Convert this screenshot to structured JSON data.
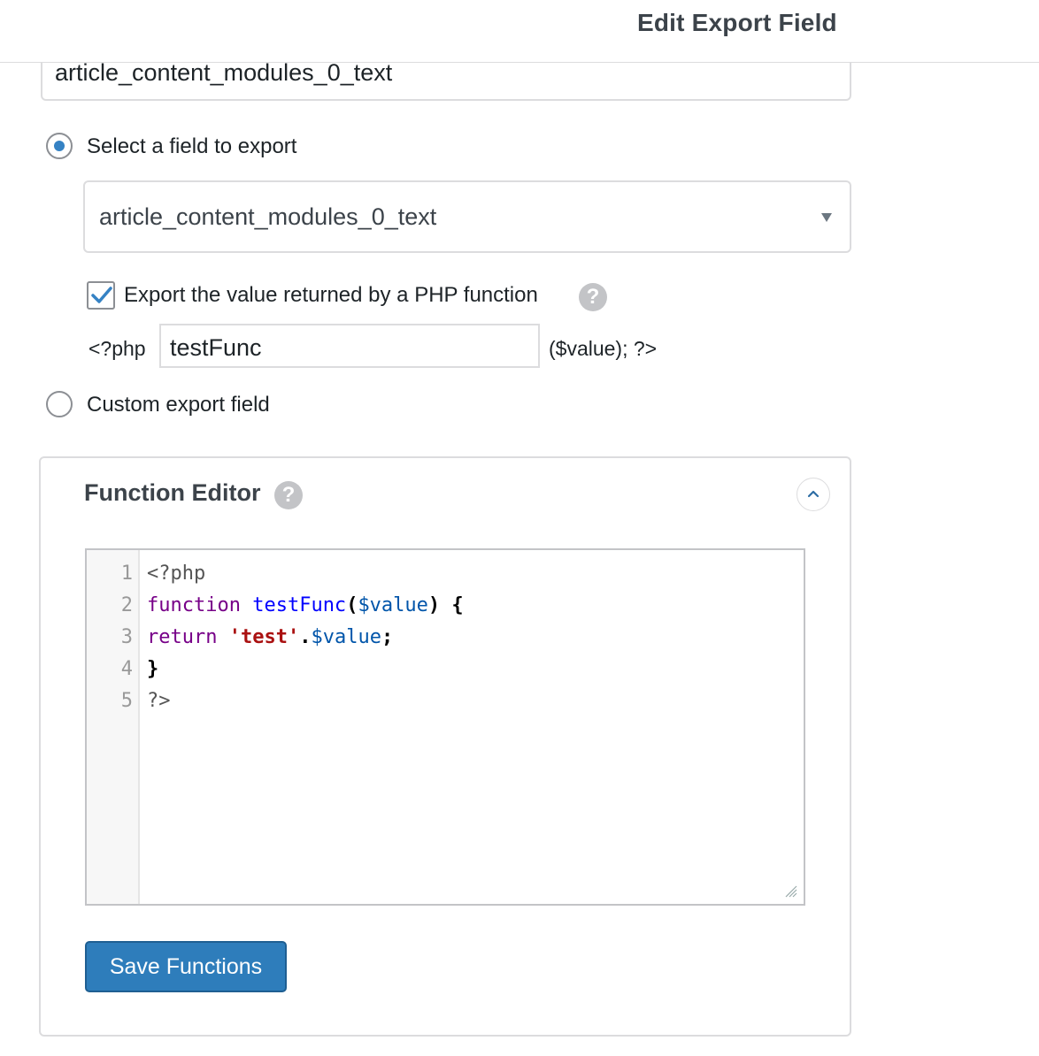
{
  "header": {
    "title": "Edit Export Field"
  },
  "top_input": {
    "value": "article_content_modules_0_text"
  },
  "radio_select": {
    "label": "Select a field to export",
    "checked": true
  },
  "select": {
    "value": "article_content_modules_0_text"
  },
  "php_function": {
    "checkbox_label": "Export the value returned by a PHP function",
    "checked": true,
    "help_icon": "?",
    "prefix": "<?php",
    "input_value": "testFunc",
    "suffix": "($value); ?>"
  },
  "radio_custom": {
    "label": "Custom export field",
    "checked": false
  },
  "function_editor": {
    "title": "Function Editor",
    "help_icon": "?",
    "line_numbers": [
      "1",
      "2",
      "3",
      "4",
      "5"
    ],
    "code_tokens": {
      "l1": "<?php",
      "l2_kw": "function",
      "l2_name": "testFunc",
      "l2_open": "(",
      "l2_var": "$value",
      "l2_close": ") {",
      "l3_kw": "return",
      "l3_str": "'test'",
      "l3_dot": ".",
      "l3_var": "$value",
      "l3_semi": ";",
      "l4": "}",
      "l5": "?>"
    },
    "save_label": "Save Functions"
  },
  "colors": {
    "accent": "#3582c4",
    "button": "#2e7dbb",
    "keyword": "#770088",
    "def": "#0000ff",
    "variable": "#0055aa",
    "string": "#aa1111"
  }
}
